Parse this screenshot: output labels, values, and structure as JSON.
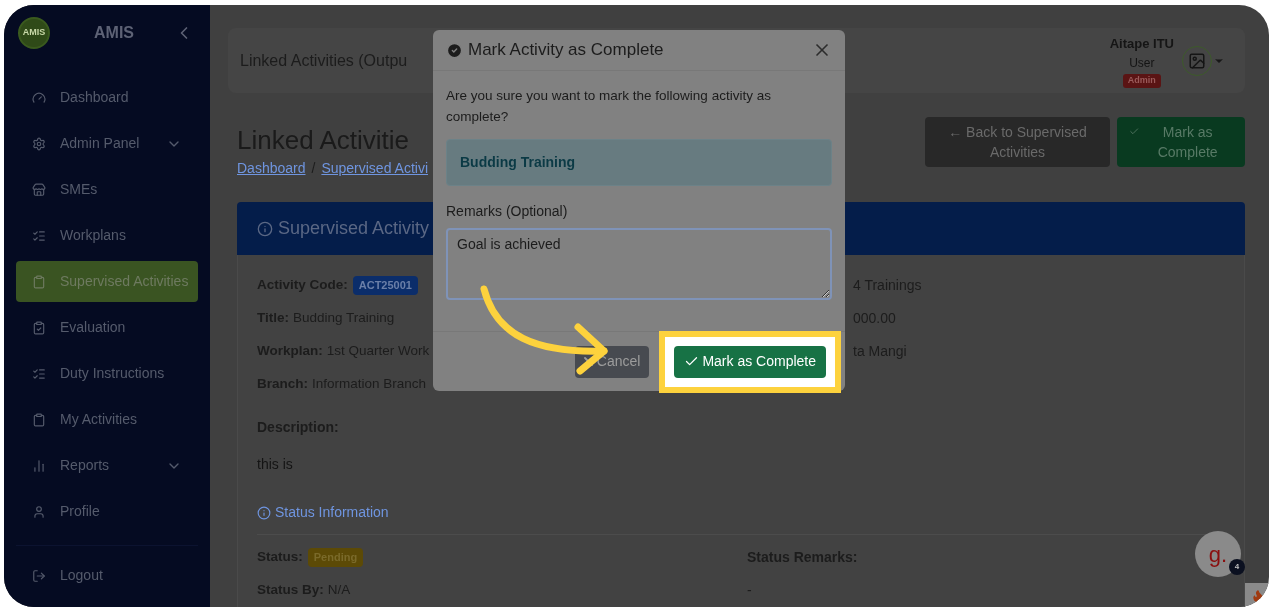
{
  "sidebar": {
    "logo_text": "AMIS",
    "title": "AMIS",
    "items": [
      {
        "label": "Dashboard",
        "selected": false,
        "submenu": false
      },
      {
        "label": "Admin Panel",
        "selected": false,
        "submenu": true
      },
      {
        "label": "SMEs",
        "selected": false,
        "submenu": false
      },
      {
        "label": "Workplans",
        "selected": false,
        "submenu": false
      },
      {
        "label": "Supervised Activities",
        "selected": true,
        "submenu": false
      },
      {
        "label": "Evaluation",
        "selected": false,
        "submenu": false
      },
      {
        "label": "Duty Instructions",
        "selected": false,
        "submenu": false
      },
      {
        "label": "My Activities",
        "selected": false,
        "submenu": false
      },
      {
        "label": "Reports",
        "selected": false,
        "submenu": true
      },
      {
        "label": "Profile",
        "selected": false,
        "submenu": false
      }
    ],
    "logout": "Logout"
  },
  "header": {
    "title": "Linked Activities (Outpu",
    "user_name": "Aitape ITU",
    "user_role": "User",
    "badge": "Admin"
  },
  "page": {
    "title": "Linked Activitie",
    "breadcrumb": [
      "Dashboard",
      "Supervised Activi"
    ],
    "breadcrumb_separator": "/",
    "buttons": [
      {
        "label": "← Back to Supervised Activities",
        "kind": "back"
      },
      {
        "label": "Mark as Complete",
        "kind": "complete"
      }
    ]
  },
  "card": {
    "title": "Supervised Activity",
    "fields": [
      {
        "label": "Activity Code:",
        "value": "ACT25001",
        "kind": "badge"
      },
      {
        "label": "Title:",
        "value": "Budding Training",
        "kind": "text"
      },
      {
        "label": "Workplan:",
        "value": "1st Quarter Work",
        "kind": "text"
      },
      {
        "label": "Branch:",
        "value": "Information Branch",
        "kind": "text"
      }
    ],
    "right_fields": [
      "4 Trainings",
      "000.00",
      "ta Mangi"
    ],
    "description_label": "Description:",
    "description": "this is",
    "status_heading": "Status Information",
    "status_fields": [
      {
        "label": "Status:",
        "value": "Pending",
        "kind": "badge"
      },
      {
        "label": "Status By:",
        "value": "N/A",
        "kind": "text"
      }
    ],
    "remarks_label": "Status Remarks:",
    "remarks_value": "-"
  },
  "modal": {
    "title": "Mark Activity as Complete",
    "question": "Are you sure you want to mark the following activity as complete?",
    "activity": "Budding Training",
    "remarks_label": "Remarks (Optional)",
    "remarks_value": "Goal is achieved",
    "cancel": "Cancel",
    "confirm": "Mark as Complete"
  },
  "chat": {
    "label": "g.",
    "count": "4"
  }
}
